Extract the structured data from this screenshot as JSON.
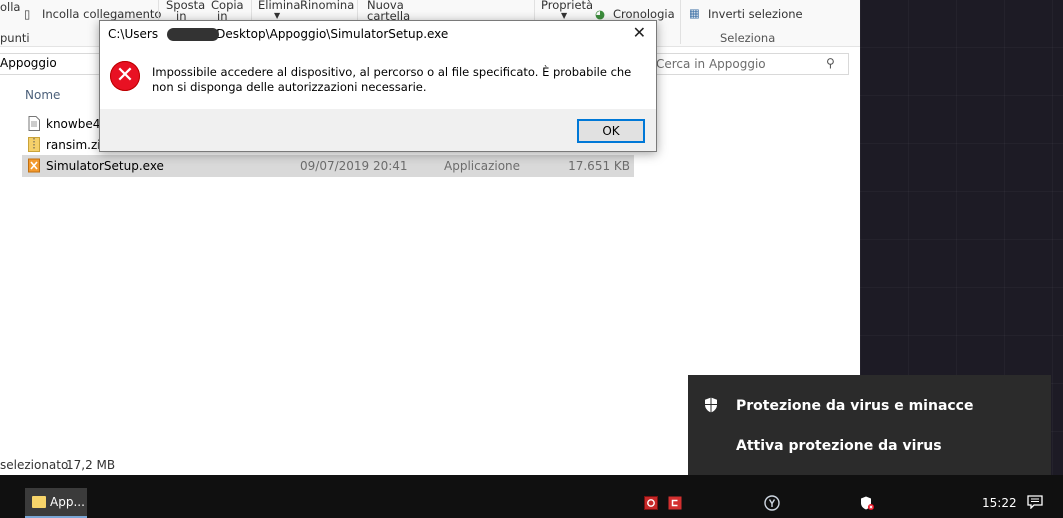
{
  "ribbon": {
    "items": [
      "olla",
      "Incolla collegamento",
      "Sposta",
      "in",
      "Copia",
      "in",
      "Elimina",
      "Rinomina",
      "Nuova",
      "cartella",
      "Proprietà",
      "Cronologia",
      "Inverti selezione",
      "Seleziona",
      "punti"
    ]
  },
  "address": {
    "path": "Appoggio",
    "search_placeholder": "Cerca in Appoggio"
  },
  "columns": {
    "name": "Nome"
  },
  "files": [
    {
      "name": "knowbe4.t",
      "date": "",
      "type": "",
      "size": ""
    },
    {
      "name": "ransim.zip",
      "date": "",
      "type": "",
      "size": ""
    },
    {
      "name": "SimulatorSetup.exe",
      "date": "09/07/2019 20:41",
      "type": "Applicazione",
      "size": "17.651 KB"
    }
  ],
  "status": {
    "selection": "selezionato",
    "size": "17,2 MB"
  },
  "dialog": {
    "title_prefix": "C:\\Users",
    "title_suffix": "Desktop\\Appoggio\\SimulatorSetup.exe",
    "message": "Impossibile accedere al dispositivo, al percorso o al file specificato. È probabile che non si disponga delle autorizzazioni necessarie.",
    "ok_label": "OK",
    "close_glyph": "✕"
  },
  "notification": {
    "line1": "Protezione da virus e minacce",
    "line2": "Attiva protezione da virus"
  },
  "taskbar": {
    "app_label": "App...",
    "clock": "15:22"
  }
}
